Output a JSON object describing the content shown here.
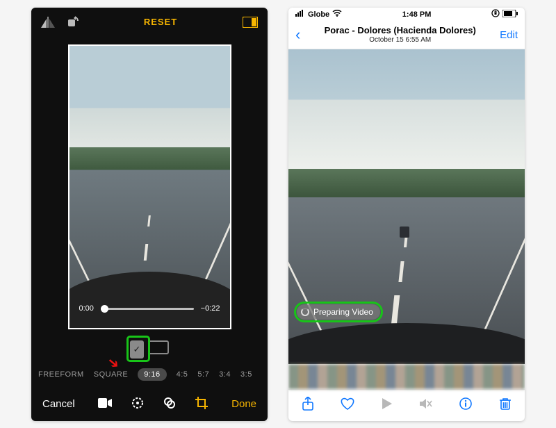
{
  "left": {
    "reset": "RESET",
    "time_start": "0:00",
    "time_remaining": "−0:22",
    "orientation_check": "✓",
    "ratios": [
      "FREEFORM",
      "SQUARE",
      "9:16",
      "4:5",
      "5:7",
      "3:4",
      "3:5"
    ],
    "selected_ratio_index": 2,
    "cancel": "Cancel",
    "done": "Done"
  },
  "right": {
    "status": {
      "carrier": "Globe",
      "time": "1:48 PM"
    },
    "title": "Porac - Dolores (Hacienda Dolores)",
    "subtitle": "October 15  6:55 AM",
    "edit": "Edit",
    "preparing": "Preparing Video"
  },
  "colors": {
    "accent": "#f7b500",
    "ios_blue": "#1178ff",
    "highlight": "#18c418"
  }
}
